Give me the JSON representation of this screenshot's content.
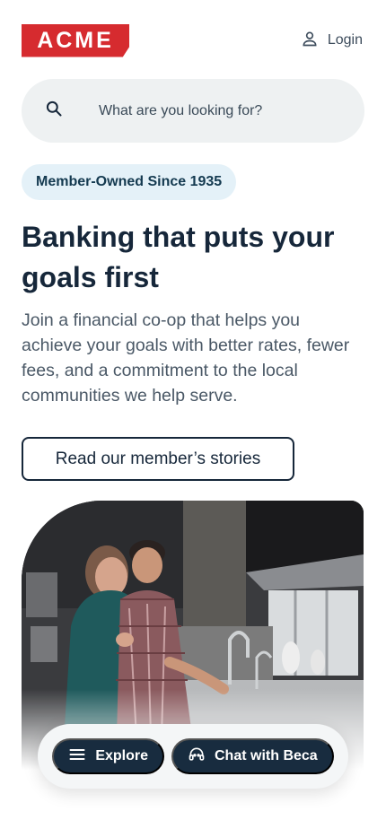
{
  "header": {
    "logo_text": "ACME",
    "login_label": "Login",
    "login_icon": "user-icon"
  },
  "search": {
    "placeholder": "What are you looking for?",
    "icon": "search-icon"
  },
  "hero": {
    "badge": "Member-Owned Since 1935",
    "headline": "Banking that puts your goals first",
    "subtext": "Join a financial co-op that helps you achieve your goals with better rates, fewer fees, and a commitment to the local communities we help serve.",
    "cta_label": "Read our member’s stories"
  },
  "dock": {
    "explore_label": "Explore",
    "explore_icon": "menu-icon",
    "chat_label": "Chat with Beca",
    "chat_icon": "headset-icon"
  },
  "colors": {
    "brand_red": "#d62b2f",
    "navy": "#182c3f",
    "badge_bg": "#e4f1f8",
    "search_bg": "#eef1f2"
  }
}
